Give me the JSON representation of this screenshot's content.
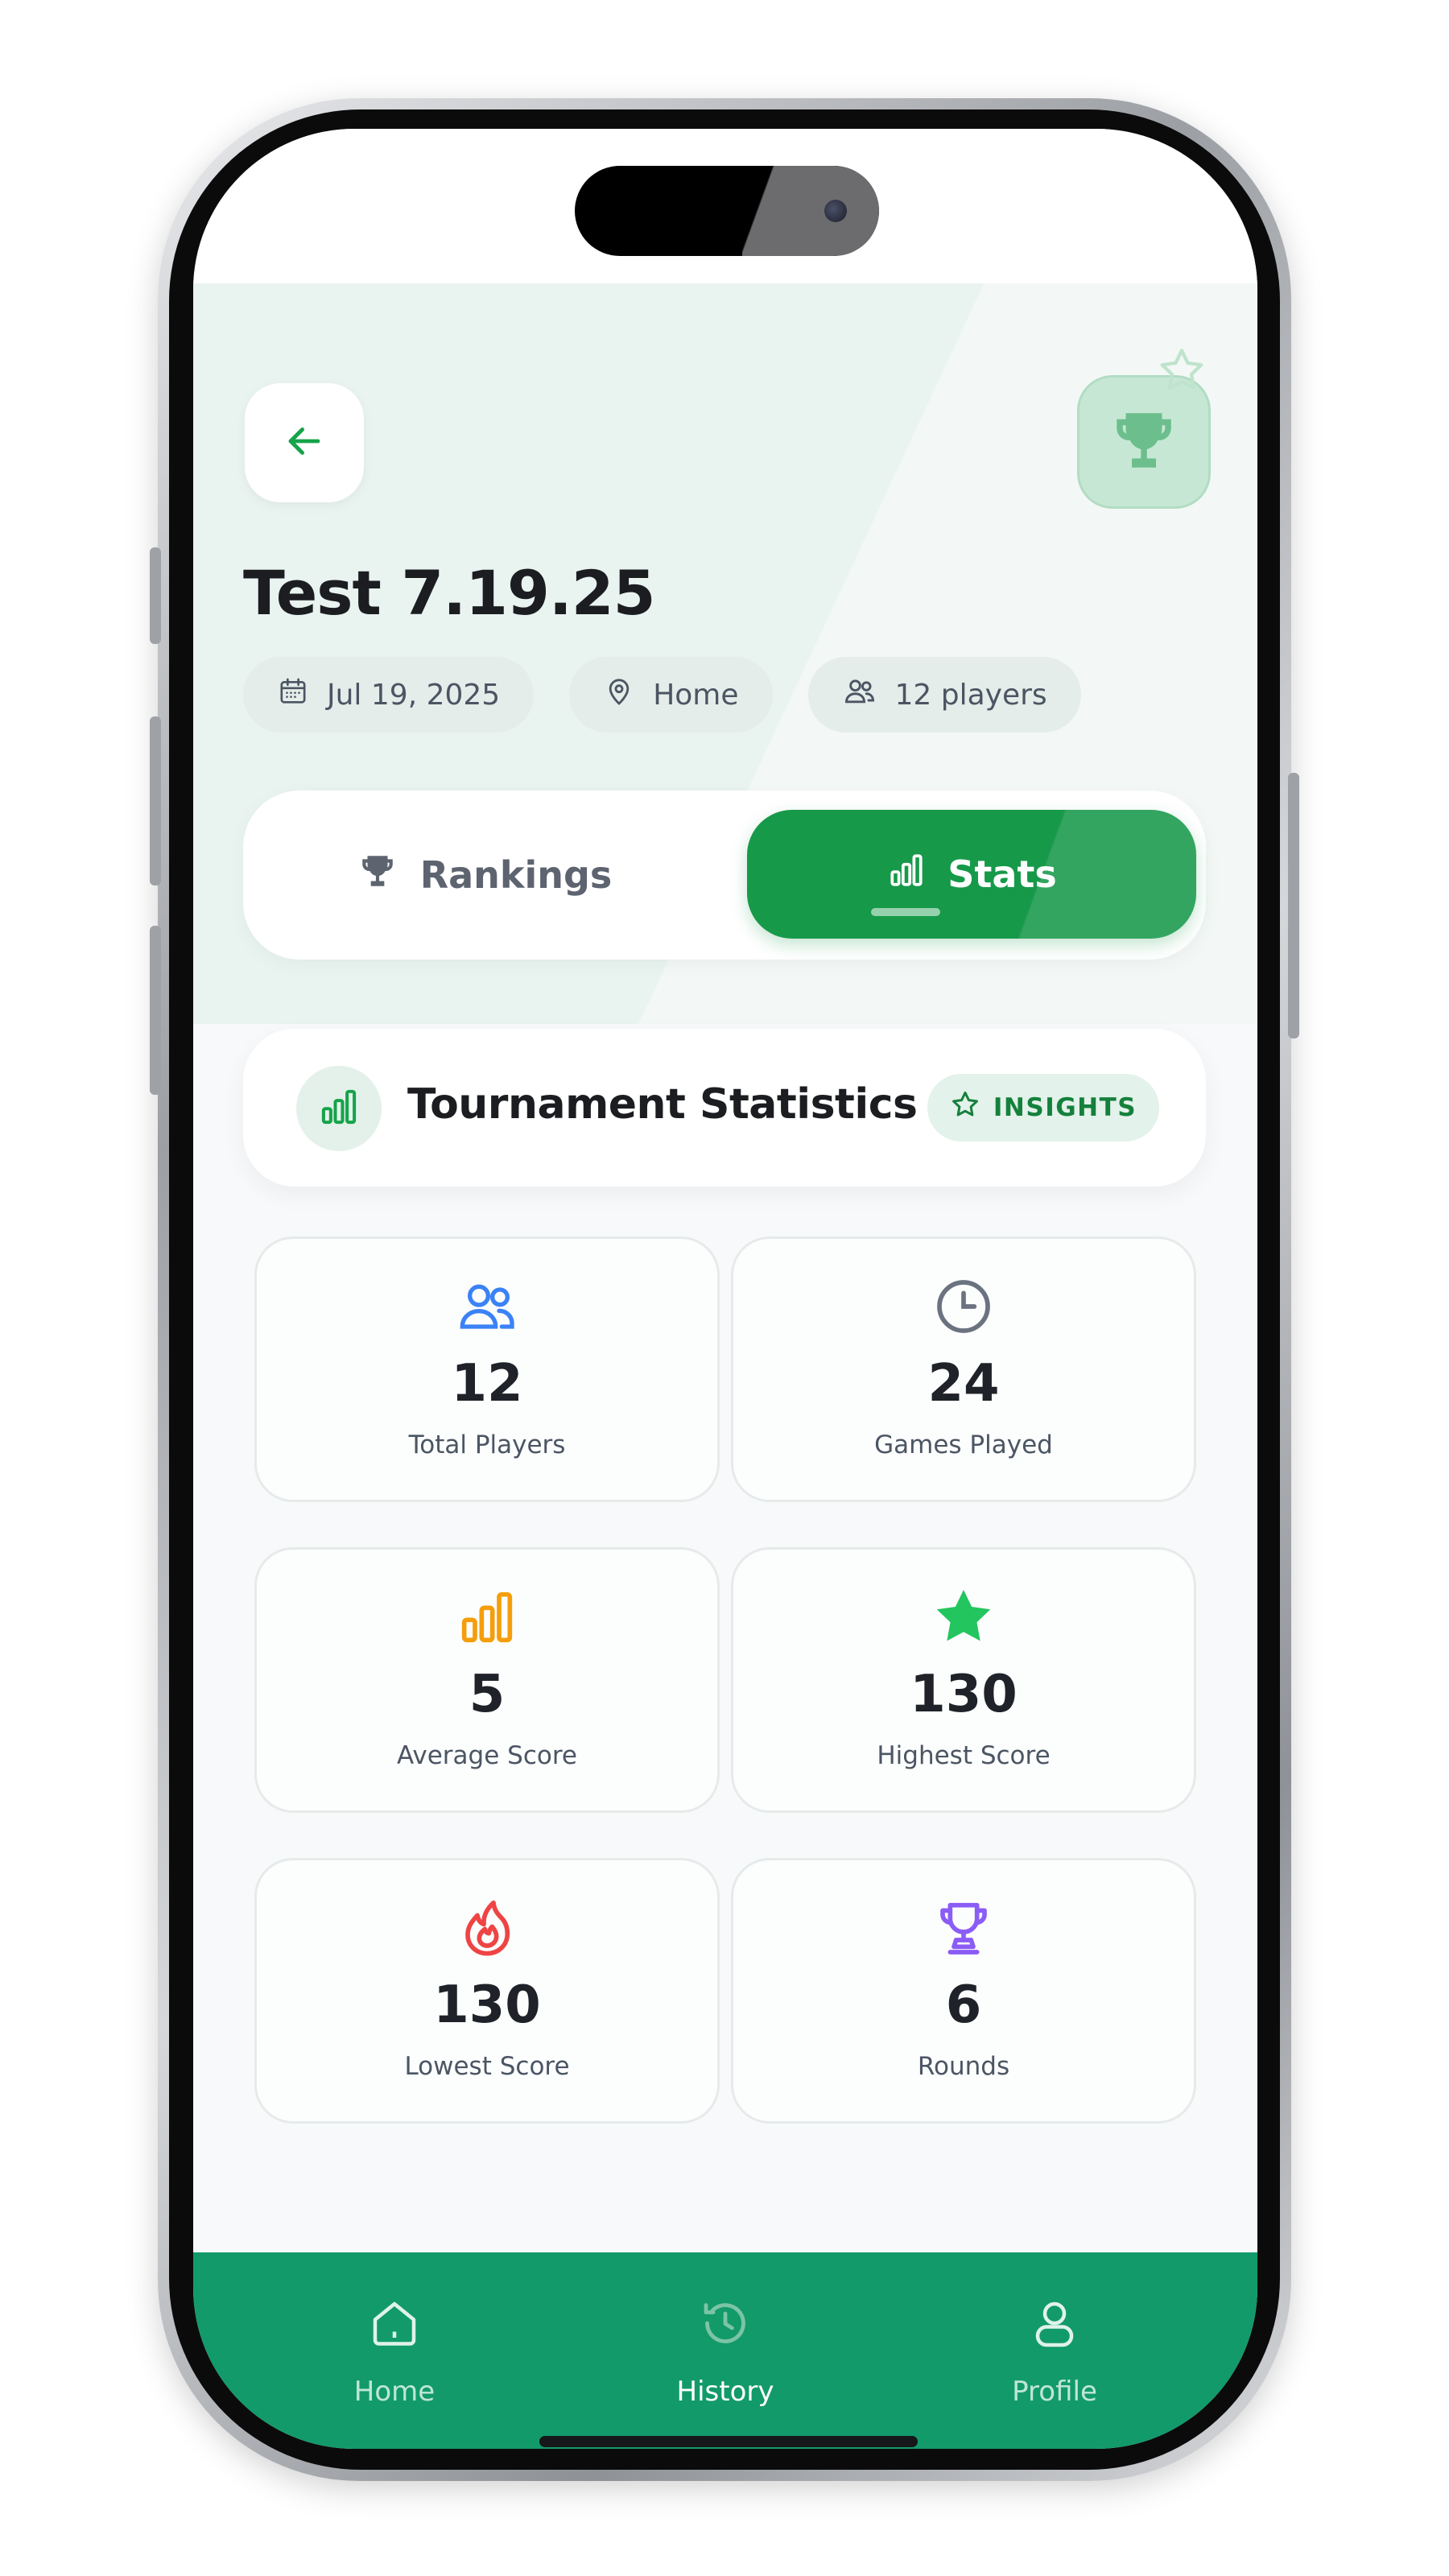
{
  "header": {
    "title": "Test 7.19.25",
    "date": "Jul 19, 2025",
    "location": "Home",
    "players": "12 players"
  },
  "tabs": [
    {
      "label": "Rankings",
      "active": false
    },
    {
      "label": "Stats",
      "active": true
    }
  ],
  "section": {
    "title": "Tournament Statistics",
    "badge": "INSIGHTS"
  },
  "stats": [
    {
      "value": "12",
      "label": "Total Players",
      "icon": "users-icon",
      "color": "#3b82f6"
    },
    {
      "value": "24",
      "label": "Games Played",
      "icon": "clock-icon",
      "color": "#6b7280"
    },
    {
      "value": "5",
      "label": "Average Score",
      "icon": "bar-chart-icon",
      "color": "#f59e0b"
    },
    {
      "value": "130",
      "label": "Highest Score",
      "icon": "star-icon",
      "color": "#22c55e"
    },
    {
      "value": "130",
      "label": "Lowest Score",
      "icon": "flame-icon",
      "color": "#ef4444"
    },
    {
      "value": "6",
      "label": "Rounds",
      "icon": "trophy-icon",
      "color": "#8b5cf6"
    }
  ],
  "nav": [
    {
      "label": "Home",
      "icon": "home-icon"
    },
    {
      "label": "History",
      "icon": "history-icon",
      "active": true
    },
    {
      "label": "Profile",
      "icon": "user-icon"
    }
  ],
  "colors": {
    "accent": "#17994a",
    "nav_background": "#129a6a",
    "header_background": "#e9f3ef"
  }
}
